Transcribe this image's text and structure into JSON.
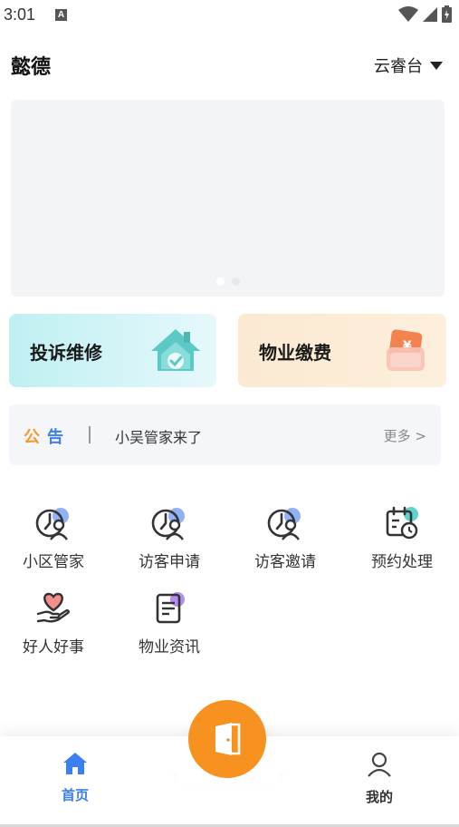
{
  "status_bar": {
    "time": "3:01",
    "notification_letter": "A"
  },
  "header": {
    "community_name": "懿德",
    "location": "云睿台"
  },
  "banner": {
    "slide_count": 2,
    "active_slide": 1
  },
  "quick_actions": [
    {
      "label": "投诉维修",
      "icon": "house-repair-icon"
    },
    {
      "label": "物业缴费",
      "icon": "yuan-wallet-icon"
    }
  ],
  "notice": {
    "badge_left": "公",
    "badge_right": "告",
    "text": "小吴管家来了",
    "more": "更多 >"
  },
  "services": [
    {
      "label": "小区管家",
      "icon": "steward-icon"
    },
    {
      "label": "访客申请",
      "icon": "visitor-apply-icon"
    },
    {
      "label": "访客邀请",
      "icon": "visitor-invite-icon"
    },
    {
      "label": "预约处理",
      "icon": "calendar-clock-icon"
    },
    {
      "label": "好人好事",
      "icon": "heart-hand-icon"
    },
    {
      "label": "物业资讯",
      "icon": "news-document-icon"
    }
  ],
  "bottom_nav": {
    "home_label": "首页",
    "mine_label": "我的",
    "center_icon": "door-icon",
    "active_color": "#3b7ff0",
    "center_color": "#f7911f"
  }
}
